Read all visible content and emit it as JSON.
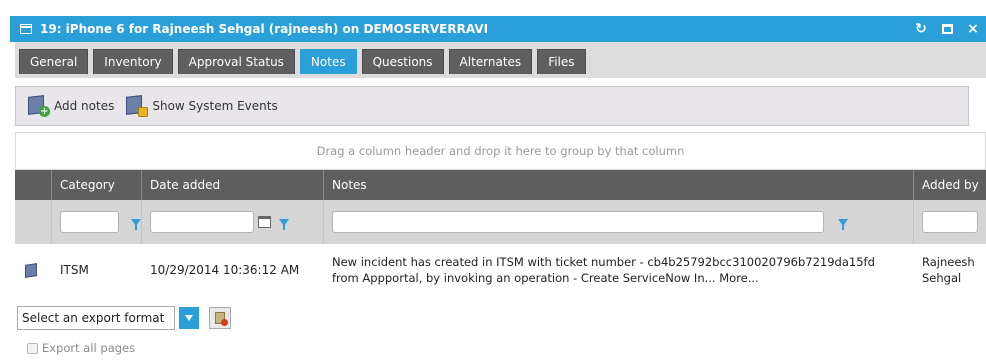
{
  "window": {
    "title": "19: iPhone 6 for Rajneesh Sehgal (rajneesh) on DEMOSERVERRAVI",
    "refresh_icon": "↻",
    "close_icon": "×"
  },
  "tabs": [
    "General",
    "Inventory",
    "Approval Status",
    "Notes",
    "Questions",
    "Alternates",
    "Files"
  ],
  "active_tab": "Notes",
  "toolbar": {
    "add_notes_label": "Add notes",
    "show_events_label": "Show System Events"
  },
  "grid": {
    "group_hint": "Drag a column header and drop it here to group by that column",
    "columns": [
      "Category",
      "Date added",
      "Notes",
      "Added by"
    ],
    "rows": [
      {
        "category": "ITSM",
        "date_added": "10/29/2014 10:36:12 AM",
        "notes_line1": "New incident has created in ITSM with ticket number - cb4b25792bcc310020796b7219da15fd",
        "notes_line2": "from Appportal, by invoking an operation - Create ServiceNow In... More...",
        "added_by_line1": "Rajneesh",
        "added_by_line2": "Sehgal"
      }
    ]
  },
  "export": {
    "selected": "Select an export format",
    "export_all_label": "Export all pages"
  },
  "colors": {
    "accent": "#2a9fd8",
    "tab_bg": "#5f5f5f",
    "header_bg": "#5e5e5e"
  }
}
